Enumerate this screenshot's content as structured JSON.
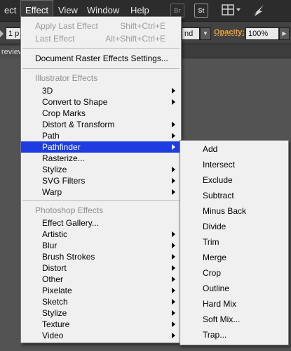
{
  "menubar": {
    "items": [
      "ect",
      "Effect",
      "View",
      "Window",
      "Help"
    ],
    "icon_labels": [
      "Br",
      "St"
    ]
  },
  "controlbar": {
    "stroke_weight": "1 p",
    "blend_mode": "nd",
    "opacity_label": "Opacity:",
    "opacity_value": "100%"
  },
  "doc_tab": "review",
  "effect_menu": {
    "apply_last": {
      "label": "Apply Last Effect",
      "shortcut": "Shift+Ctrl+E"
    },
    "last_effect": {
      "label": "Last Effect",
      "shortcut": "Alt+Shift+Ctrl+E"
    },
    "raster_settings": "Document Raster Effects Settings...",
    "illustrator_header": "Illustrator Effects",
    "illustrator_items": [
      "3D",
      "Convert to Shape",
      "Crop Marks",
      "Distort & Transform",
      "Path",
      "Pathfinder",
      "Rasterize...",
      "Stylize",
      "SVG Filters",
      "Warp"
    ],
    "photoshop_header": "Photoshop Effects",
    "photoshop_items": [
      "Effect Gallery...",
      "Artistic",
      "Blur",
      "Brush Strokes",
      "Distort",
      "Other",
      "Pixelate",
      "Sketch",
      "Stylize",
      "Texture",
      "Video"
    ]
  },
  "pathfinder_menu": {
    "items": [
      "Add",
      "Intersect",
      "Exclude",
      "Subtract",
      "Minus Back",
      "Divide",
      "Trim",
      "Merge",
      "Crop",
      "Outline",
      "Hard Mix",
      "Soft Mix...",
      "Trap..."
    ]
  },
  "colors": {
    "highlight": "#1e3ce0",
    "menu_bg": "#f0f0f0",
    "app_bg": "#535353"
  }
}
